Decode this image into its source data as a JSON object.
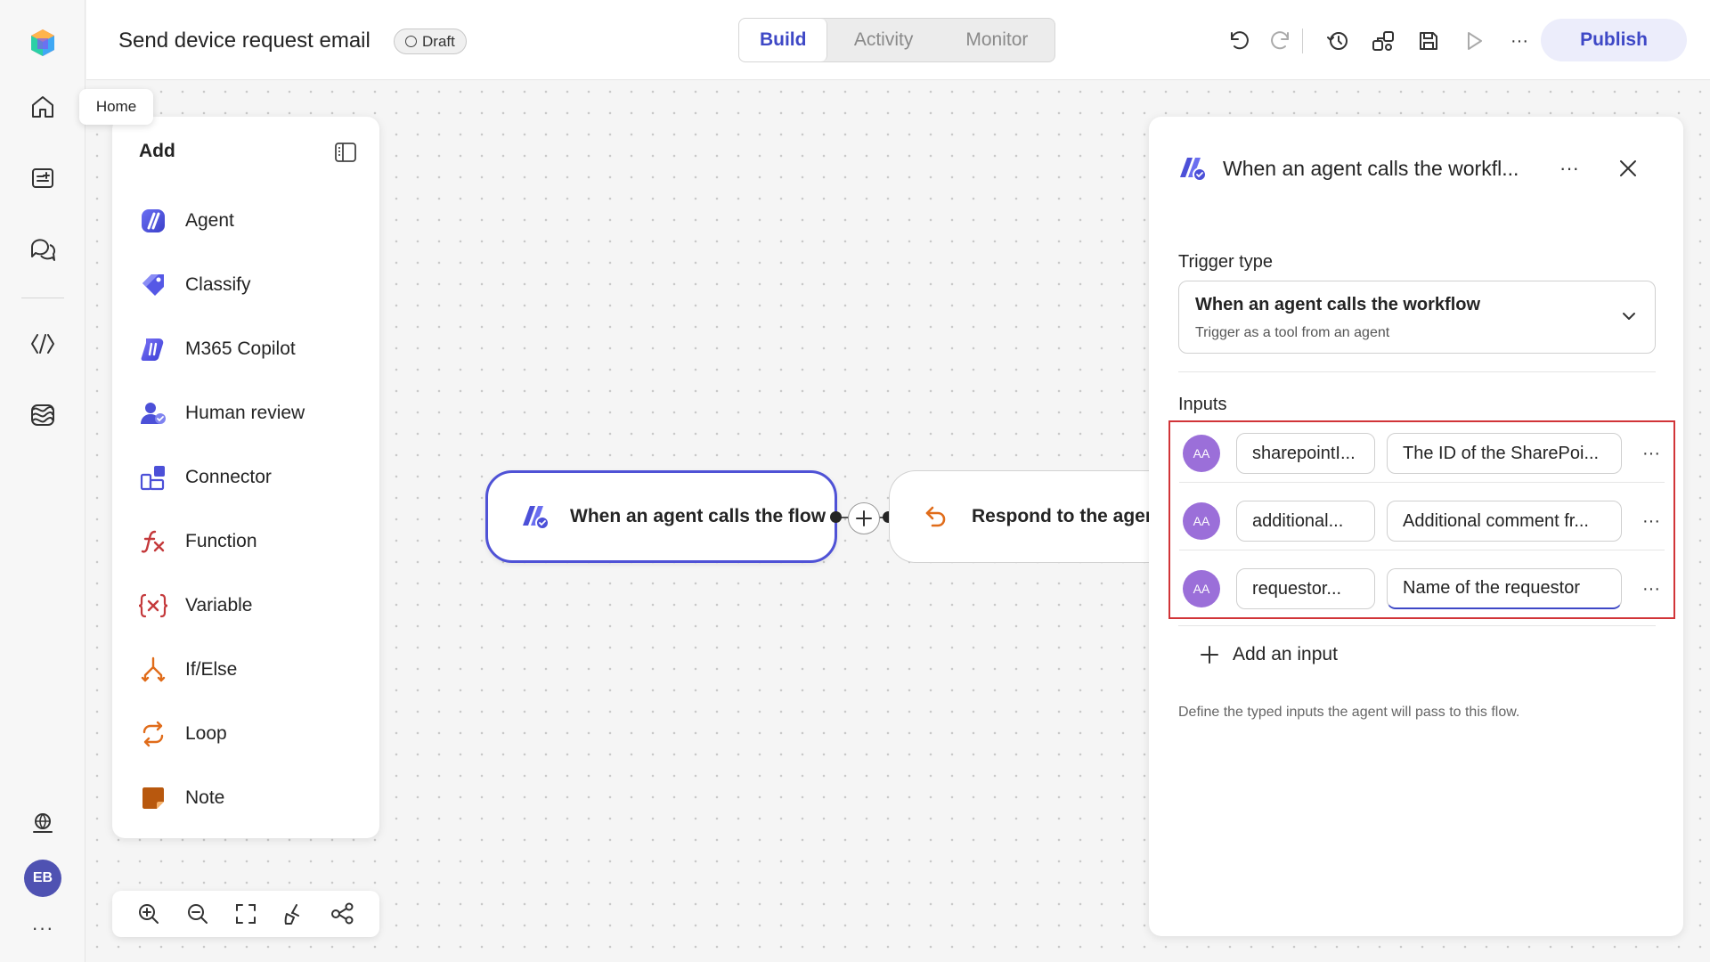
{
  "header": {
    "title": "Send device request email",
    "status": "Draft",
    "tabs": [
      "Build",
      "Activity",
      "Monitor"
    ],
    "active_tab": "Build",
    "publish_label": "Publish"
  },
  "rail": {
    "tooltip": "Home",
    "user_initials": "EB",
    "more": "···"
  },
  "add_panel": {
    "title": "Add",
    "items": [
      {
        "label": "Agent",
        "icon": "agent-icon"
      },
      {
        "label": "Classify",
        "icon": "classify-icon"
      },
      {
        "label": "M365 Copilot",
        "icon": "copilot-icon"
      },
      {
        "label": "Human review",
        "icon": "human-review-icon"
      },
      {
        "label": "Connector",
        "icon": "connector-icon"
      },
      {
        "label": "Function",
        "icon": "function-icon"
      },
      {
        "label": "Variable",
        "icon": "variable-icon"
      },
      {
        "label": "If/Else",
        "icon": "if-else-icon"
      },
      {
        "label": "Loop",
        "icon": "loop-icon"
      },
      {
        "label": "Note",
        "icon": "note-icon"
      }
    ]
  },
  "flow": {
    "node_1": "When an agent calls the flow",
    "node_2": "Respond to the agent"
  },
  "details": {
    "title": "When an agent calls the workfl...",
    "more": "···",
    "trigger_type_label": "Trigger type",
    "trigger_value": "When an agent calls the workflow",
    "trigger_sub": "Trigger as a tool from an agent",
    "inputs_label": "Inputs",
    "inputs": [
      {
        "type_badge": "AA",
        "name": "sharepointI...",
        "description": "The ID of the SharePoi..."
      },
      {
        "type_badge": "AA",
        "name": "additional...",
        "description": "Additional comment fr..."
      },
      {
        "type_badge": "AA",
        "name": "requestor...",
        "description": "Name of the requestor"
      }
    ],
    "row_more": "···",
    "add_input_label": "Add an input",
    "helper_text": "Define the typed inputs the agent will pass to this flow."
  },
  "colors": {
    "accent": "#3e48c6",
    "highlight_border": "#d13438",
    "text_type_badge": "#9b6fd9"
  }
}
